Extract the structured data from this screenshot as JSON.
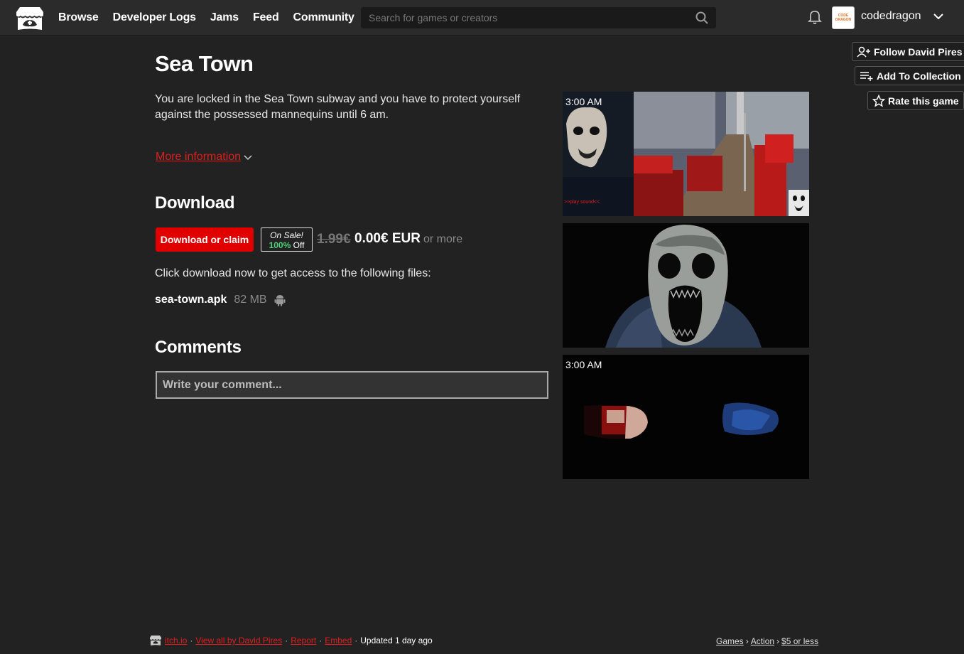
{
  "header": {
    "nav": [
      "Browse",
      "Developer Logs",
      "Jams",
      "Feed",
      "Community"
    ],
    "search_placeholder": "Search for games or creators",
    "avatar_text": "CODE DRAGON",
    "username": "codedragon"
  },
  "actions": {
    "follow": "Follow David Pires",
    "collection": "Add To Collection",
    "rate": "Rate this game"
  },
  "game": {
    "title": "Sea Town",
    "description": "You are locked in the Sea Town subway and you have to protect yourself against the possessed mannequins until 6 am.",
    "more_info": "More information"
  },
  "download": {
    "heading": "Download",
    "button": "Download or claim",
    "sale_label": "On Sale!",
    "sale_percent": "100%",
    "sale_off": "Off",
    "old_price": "1.99€",
    "new_price": "0.00€ EUR",
    "or_more": "or more",
    "access_text": "Click download now to get access to the following files:",
    "file_name": "sea-town.apk",
    "file_size": "82 MB"
  },
  "comments": {
    "heading": "Comments",
    "placeholder": "Write your comment..."
  },
  "screenshots": {
    "shot1_time": "3:00 AM",
    "shot1_caption": ">>play sound<<",
    "shot3_time": "3:00 AM"
  },
  "footer": {
    "itch": "itch.io",
    "view_all": "View all by David Pires",
    "report": "Report",
    "embed": "Embed",
    "updated": "Updated 1 day ago",
    "crumbs": [
      "Games",
      "Action",
      "$5 or less"
    ]
  },
  "colors": {
    "accent": "#e00000",
    "background": "#222222",
    "sale_green": "#4fd17a"
  }
}
